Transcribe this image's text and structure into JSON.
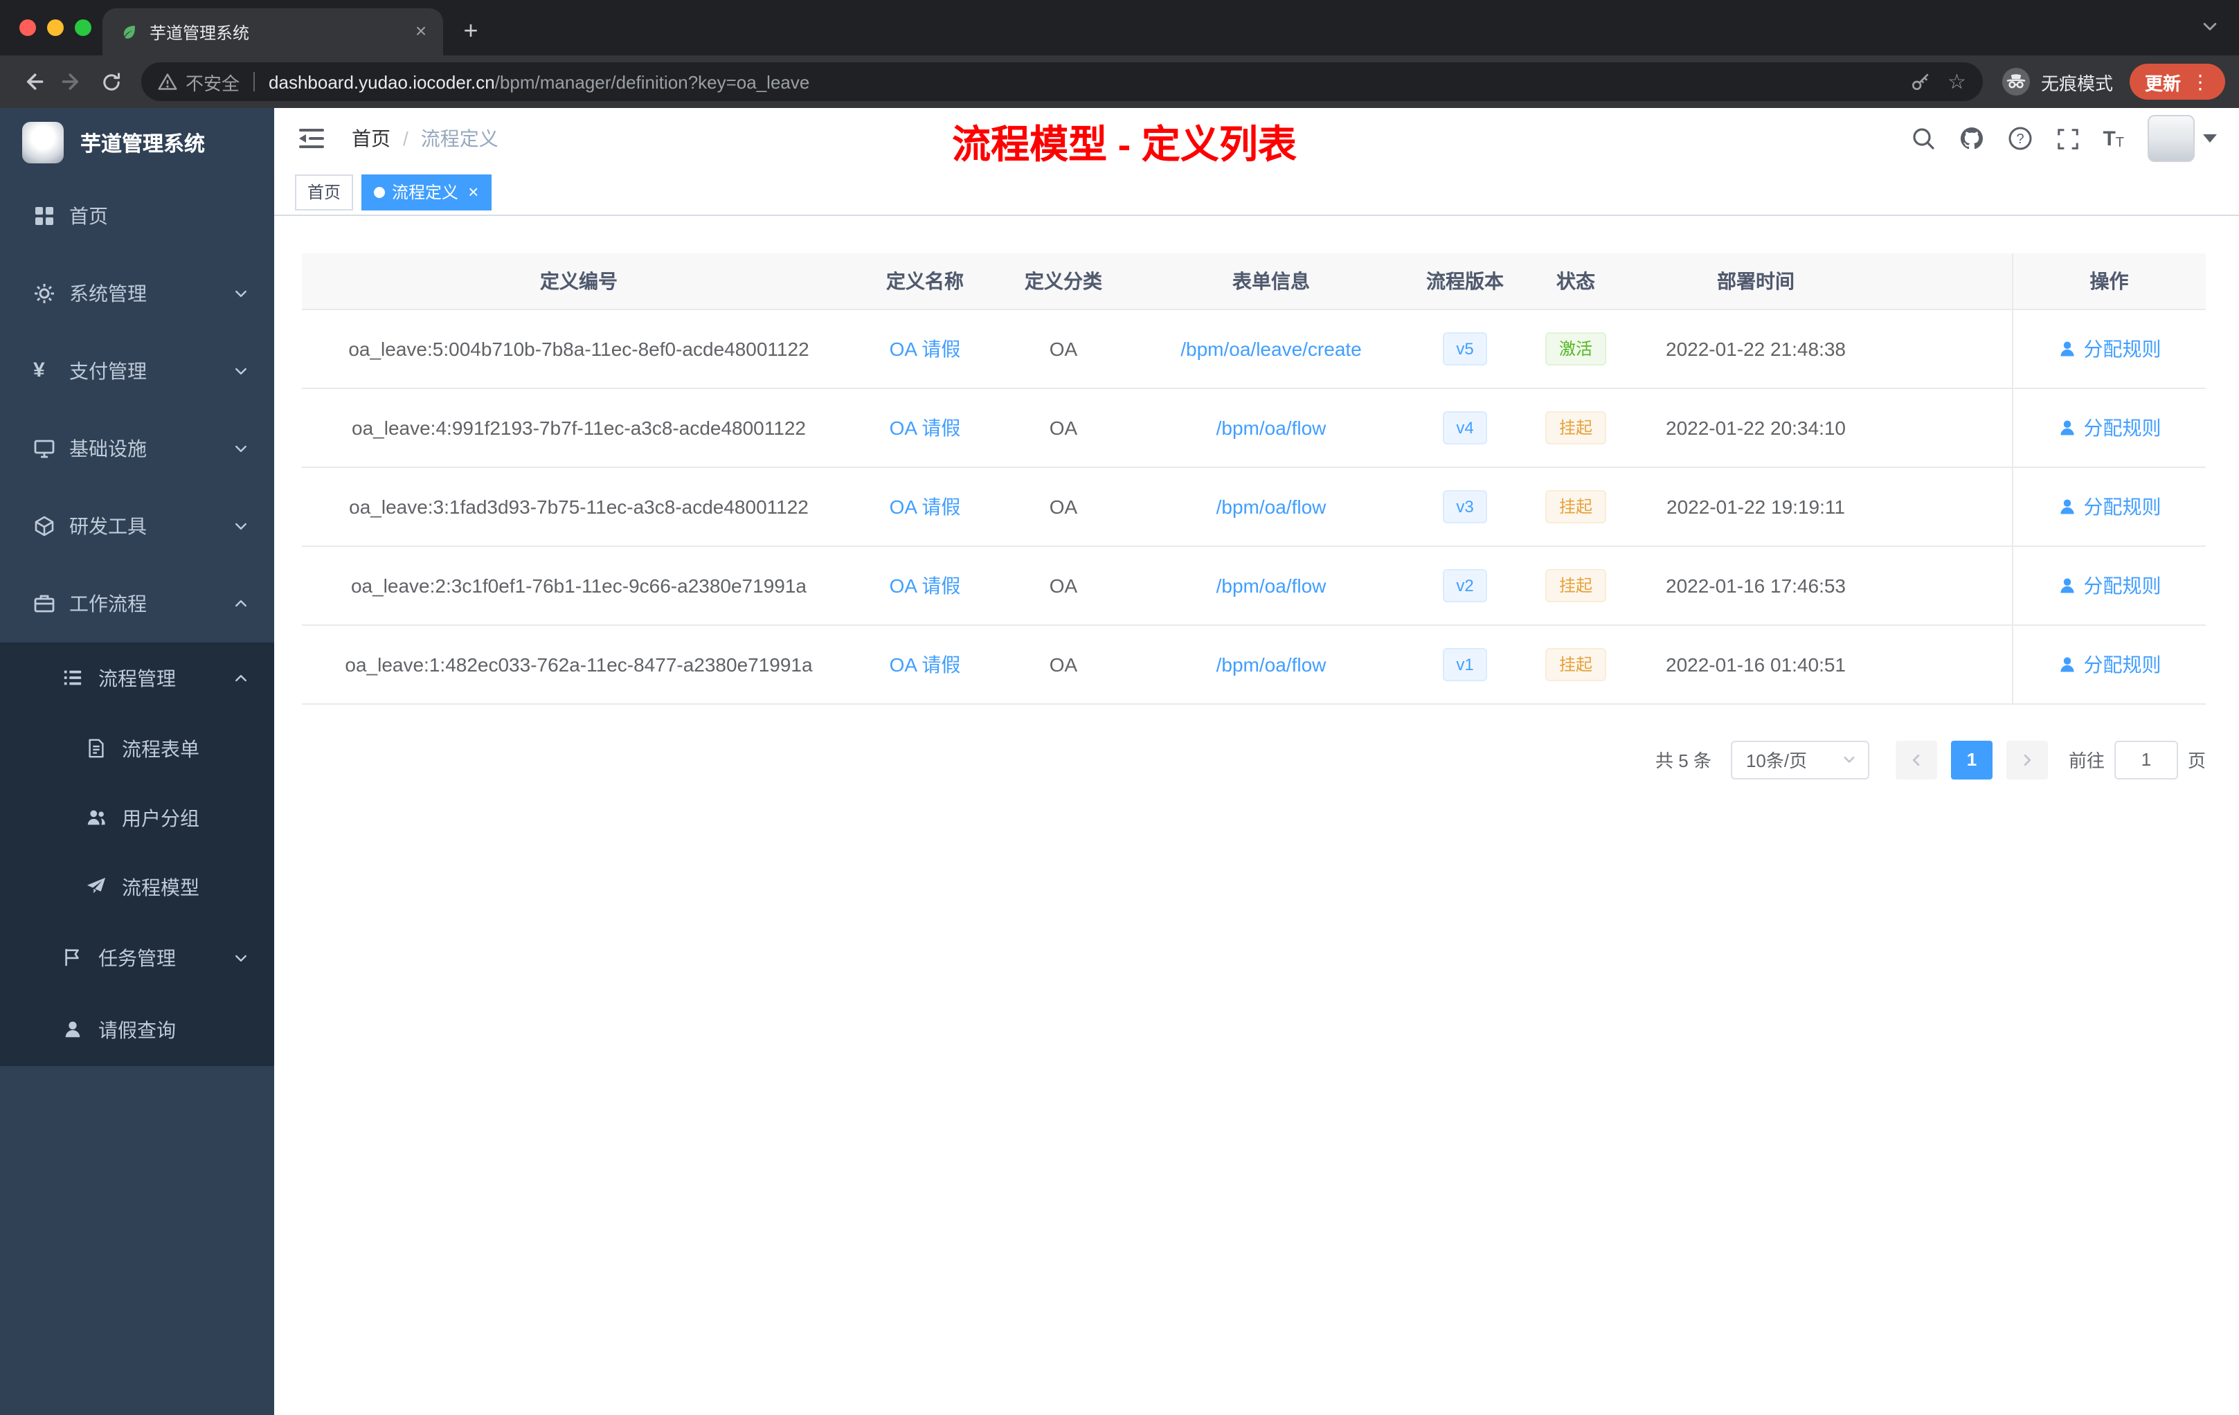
{
  "browser": {
    "tab_title": "芋道管理系统",
    "security_text": "不安全",
    "url_host": "dashboard.yudao.iocoder.cn",
    "url_path": "/bpm/manager/definition?key=oa_leave",
    "incognito_text": "无痕模式",
    "update_text": "更新"
  },
  "header": {
    "breadcrumb_home": "首页",
    "breadcrumb_separator": "/",
    "breadcrumb_current": "流程定义",
    "annotation": "流程模型 - 定义列表"
  },
  "tags": {
    "home": "首页",
    "active": "流程定义"
  },
  "sidebar": {
    "logo_title": "芋道管理系统",
    "items": [
      {
        "label": "首页"
      },
      {
        "label": "系统管理"
      },
      {
        "label": "支付管理"
      },
      {
        "label": "基础设施"
      },
      {
        "label": "研发工具"
      },
      {
        "label": "工作流程"
      }
    ],
    "sub": {
      "process_mgmt": "流程管理",
      "process_form": "流程表单",
      "user_group": "用户分组",
      "process_model": "流程模型",
      "task_mgmt": "任务管理",
      "leave_query": "请假查询"
    }
  },
  "table": {
    "columns": [
      "定义编号",
      "定义名称",
      "定义分类",
      "表单信息",
      "流程版本",
      "状态",
      "部署时间",
      "操作"
    ],
    "rows": [
      {
        "id": "oa_leave:5:004b710b-7b8a-11ec-8ef0-acde48001122",
        "name": "OA 请假",
        "category": "OA",
        "form": "/bpm/oa/leave/create",
        "version": "v5",
        "status": "激活",
        "status_type": "success",
        "time": "2022-01-22 21:48:38",
        "action": "分配规则"
      },
      {
        "id": "oa_leave:4:991f2193-7b7f-11ec-a3c8-acde48001122",
        "name": "OA 请假",
        "category": "OA",
        "form": "/bpm/oa/flow",
        "version": "v4",
        "status": "挂起",
        "status_type": "warning",
        "time": "2022-01-22 20:34:10",
        "action": "分配规则"
      },
      {
        "id": "oa_leave:3:1fad3d93-7b75-11ec-a3c8-acde48001122",
        "name": "OA 请假",
        "category": "OA",
        "form": "/bpm/oa/flow",
        "version": "v3",
        "status": "挂起",
        "status_type": "warning",
        "time": "2022-01-22 19:19:11",
        "action": "分配规则"
      },
      {
        "id": "oa_leave:2:3c1f0ef1-76b1-11ec-9c66-a2380e71991a",
        "name": "OA 请假",
        "category": "OA",
        "form": "/bpm/oa/flow",
        "version": "v2",
        "status": "挂起",
        "status_type": "warning",
        "time": "2022-01-16 17:46:53",
        "action": "分配规则"
      },
      {
        "id": "oa_leave:1:482ec033-762a-11ec-8477-a2380e71991a",
        "name": "OA 请假",
        "category": "OA",
        "form": "/bpm/oa/flow",
        "version": "v1",
        "status": "挂起",
        "status_type": "warning",
        "time": "2022-01-16 01:40:51",
        "action": "分配规则"
      }
    ]
  },
  "pagination": {
    "total_label": "共 5 条",
    "page_size_label": "10条/页",
    "current_page": "1",
    "goto_label": "前往",
    "goto_value": "1",
    "page_unit_label": "页"
  }
}
